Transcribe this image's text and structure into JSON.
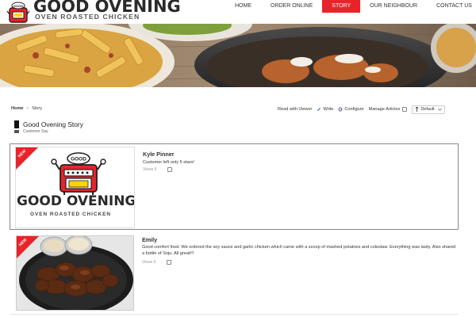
{
  "brand": {
    "title": "GOOD OVENING",
    "subtitle": "OVEN ROASTED CHICKEN",
    "mascot_sign": "GOOD"
  },
  "nav": {
    "items": [
      {
        "label": "HOME"
      },
      {
        "label": "ORDER ONLINE"
      },
      {
        "label": "STORY"
      },
      {
        "label": "OUR NEIGHBOUR"
      },
      {
        "label": "CONTACT US"
      }
    ],
    "active": "STORY"
  },
  "breadcrumb": {
    "home": "Home",
    "separator": ">",
    "current": "Story"
  },
  "toolbar": {
    "read_with_viewer": "Read with Viewer",
    "write": "Write",
    "configure": "Configure",
    "manage_articles": "Manage Articles",
    "sort_select": "Default",
    "write_icon": "pencil-icon",
    "configure_icon": "gear-icon",
    "sort_icon": "sort-icon"
  },
  "board": {
    "title": "Good Ovening Story",
    "subtitle": "Customer Say"
  },
  "posts": [
    {
      "badge": "NEW",
      "author": "Kyle Pinner",
      "body": "Customer left only 5 stars!",
      "views_label": "Views",
      "views": "5",
      "thumb": {
        "brand_title": "GOOD OVENING",
        "brand_sub": "OVEN ROASTED CHICKEN",
        "mascot_sign": "GOOD"
      }
    },
    {
      "badge": "NEW",
      "author": "Emily",
      "body": "Good comfort food. We ordered the soy sauce and garlic chicken which came with a scoop of mashed potatoes and coleslaw. Everything was tasty. Also shared a bottle of Soju. All great!!!",
      "views_label": "Views",
      "views": "5"
    }
  ],
  "colors": {
    "accent": "#e8232a",
    "text": "#333333"
  }
}
